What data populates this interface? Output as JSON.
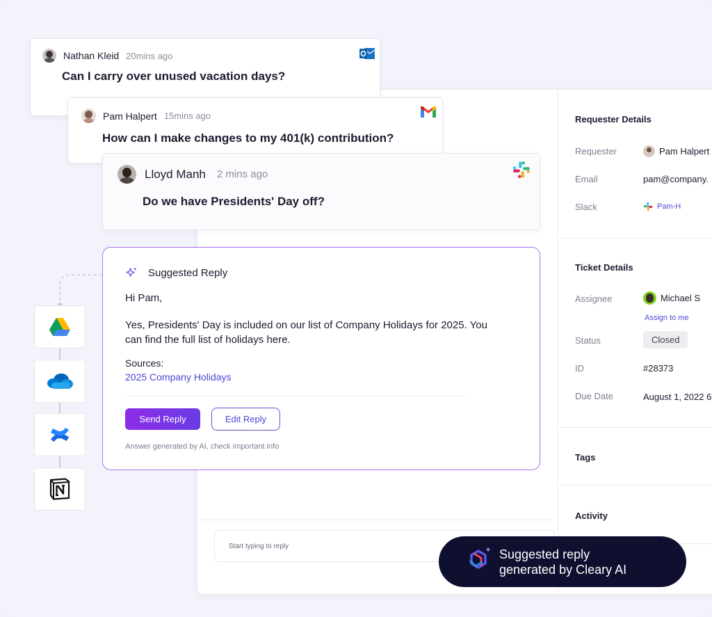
{
  "messages": [
    {
      "name": "Nathan Kleid",
      "time": "20mins ago",
      "text": "Can I carry over unused vacation days?",
      "source_icon": "outlook-icon"
    },
    {
      "name": "Pam Halpert",
      "time": "15mins ago",
      "text": "How can I make changes to my 401(k) contribution?",
      "source_icon": "gmail-icon"
    },
    {
      "name": "Lloyd Manh",
      "time": "2 mins ago",
      "text": "Do we have Presidents' Day off?",
      "source_icon": "slack-icon"
    }
  ],
  "suggested_reply": {
    "title": "Suggested Reply",
    "greeting": "Hi Pam,",
    "line1": "Yes, Presidents' Day is included on our list of Company Holidays for 2025. You",
    "line2": "can find the full list of holidays here.",
    "sources_label": "Sources:",
    "source_link": "2025 Company Holidays",
    "send_label": "Send Reply",
    "edit_label": "Edit Reply",
    "disclaimer": "Answer generated by AI, check important info"
  },
  "reply_input": {
    "placeholder": "Start typing to reply"
  },
  "requester_details": {
    "title": "Requester Details",
    "requester_label": "Requester",
    "requester_value": "Pam Halpert",
    "email_label": "Email",
    "email_value": "pam@company.",
    "slack_label": "Slack",
    "slack_value": "Pam-H"
  },
  "ticket_details": {
    "title": "Ticket Details",
    "assignee_label": "Assignee",
    "assignee_value": "Michael S",
    "assign_link": "Assign to me",
    "status_label": "Status",
    "status_value": "Closed",
    "id_label": "ID",
    "id_value": "#28373",
    "due_label": "Due Date",
    "due_value": "August 1, 2022 6:"
  },
  "tags_title": "Tags",
  "activity_title": "Activity",
  "integrations": [
    "google-drive-icon",
    "onedrive-icon",
    "confluence-icon",
    "notion-icon"
  ],
  "cleary_badge": {
    "line1": "Suggested reply",
    "line2": "generated by Cleary AI"
  },
  "colors": {
    "accent": "#4c47d6",
    "purple_border": "#a771ee",
    "pill_bg": "#0f1030"
  }
}
